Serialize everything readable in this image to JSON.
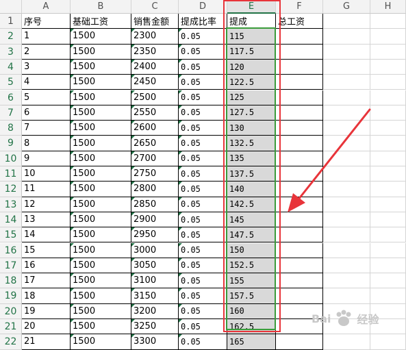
{
  "columns": [
    "A",
    "B",
    "C",
    "D",
    "E",
    "F",
    "G",
    "H"
  ],
  "selected_column": "E",
  "header_row": {
    "row_number": "1",
    "cells": [
      "序号",
      "基础工资",
      "销售金额",
      "提成比率",
      "提成",
      "总工资",
      "",
      ""
    ]
  },
  "rows": [
    {
      "row": "2",
      "seq": "1",
      "base": "1500",
      "sales": "2300",
      "rate": "0.05",
      "commission": "115"
    },
    {
      "row": "3",
      "seq": "2",
      "base": "1500",
      "sales": "2350",
      "rate": "0.05",
      "commission": "117.5"
    },
    {
      "row": "4",
      "seq": "3",
      "base": "1500",
      "sales": "2400",
      "rate": "0.05",
      "commission": "120"
    },
    {
      "row": "5",
      "seq": "4",
      "base": "1500",
      "sales": "2450",
      "rate": "0.05",
      "commission": "122.5"
    },
    {
      "row": "6",
      "seq": "5",
      "base": "1500",
      "sales": "2500",
      "rate": "0.05",
      "commission": "125"
    },
    {
      "row": "7",
      "seq": "6",
      "base": "1500",
      "sales": "2550",
      "rate": "0.05",
      "commission": "127.5"
    },
    {
      "row": "8",
      "seq": "7",
      "base": "1500",
      "sales": "2600",
      "rate": "0.05",
      "commission": "130"
    },
    {
      "row": "9",
      "seq": "8",
      "base": "1500",
      "sales": "2650",
      "rate": "0.05",
      "commission": "132.5"
    },
    {
      "row": "10",
      "seq": "9",
      "base": "1500",
      "sales": "2700",
      "rate": "0.05",
      "commission": "135"
    },
    {
      "row": "11",
      "seq": "10",
      "base": "1500",
      "sales": "2750",
      "rate": "0.05",
      "commission": "137.5"
    },
    {
      "row": "12",
      "seq": "11",
      "base": "1500",
      "sales": "2800",
      "rate": "0.05",
      "commission": "140"
    },
    {
      "row": "13",
      "seq": "12",
      "base": "1500",
      "sales": "2850",
      "rate": "0.05",
      "commission": "142.5"
    },
    {
      "row": "14",
      "seq": "13",
      "base": "1500",
      "sales": "2900",
      "rate": "0.05",
      "commission": "145"
    },
    {
      "row": "15",
      "seq": "14",
      "base": "1500",
      "sales": "2950",
      "rate": "0.05",
      "commission": "147.5"
    },
    {
      "row": "16",
      "seq": "15",
      "base": "1500",
      "sales": "3000",
      "rate": "0.05",
      "commission": "150"
    },
    {
      "row": "17",
      "seq": "16",
      "base": "1500",
      "sales": "3050",
      "rate": "0.05",
      "commission": "152.5"
    },
    {
      "row": "18",
      "seq": "17",
      "base": "1500",
      "sales": "3100",
      "rate": "0.05",
      "commission": "155"
    },
    {
      "row": "19",
      "seq": "18",
      "base": "1500",
      "sales": "3150",
      "rate": "0.05",
      "commission": "157.5"
    },
    {
      "row": "20",
      "seq": "19",
      "base": "1500",
      "sales": "3200",
      "rate": "0.05",
      "commission": "160"
    },
    {
      "row": "21",
      "seq": "20",
      "base": "1500",
      "sales": "3250",
      "rate": "0.05",
      "commission": "162.5"
    },
    {
      "row": "22",
      "seq": "21",
      "base": "1500",
      "sales": "3300",
      "rate": "0.05",
      "commission": "165"
    }
  ],
  "watermark": {
    "text": "经验",
    "brand": "Bai",
    "brand2": "百"
  },
  "colors": {
    "highlight_red": "#e8343a",
    "selection_green": "#3a9b3a",
    "excel_green": "#217346",
    "selection_fill": "#d9d9d9"
  }
}
